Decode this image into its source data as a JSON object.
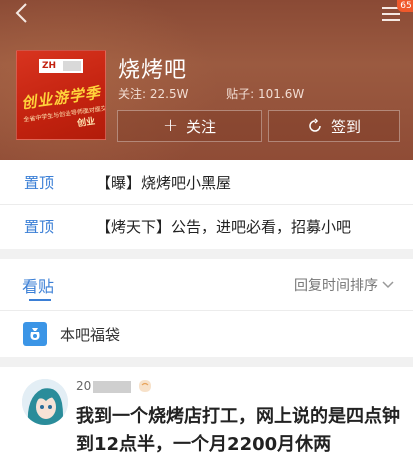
{
  "header": {
    "notification_count": "65",
    "forum": {
      "name": "烧烤吧",
      "followers_label": "关注:",
      "followers_value": "22.5W",
      "posts_label": "贴子:",
      "posts_value": "101.6W",
      "avatar": {
        "logo_text": "ZH",
        "slogan": "创业游学季",
        "slogan_sub": "创业",
        "small_print": "全省中学生与创业导师面对面交流"
      }
    },
    "follow_label": "关注",
    "signin_label": "签到"
  },
  "pinned": [
    {
      "tag": "置顶",
      "text": "【曝】烧烤吧小黑屋"
    },
    {
      "tag": "置顶",
      "text": "【烤天下】公告，进吧必看，招募小吧"
    }
  ],
  "tabs": {
    "active": "看贴",
    "sort": "回复时间排序"
  },
  "lucky_bag": {
    "label": "本吧福袋"
  },
  "post": {
    "username_prefix": "20",
    "content": "我到一个烧烤店打工，网上说的是四点钟到12点半，一个月2200月休两"
  },
  "colors": {
    "accent_blue": "#3b7fd6",
    "header_brown": "#8f4c36",
    "badge_orange": "#f0592b"
  }
}
